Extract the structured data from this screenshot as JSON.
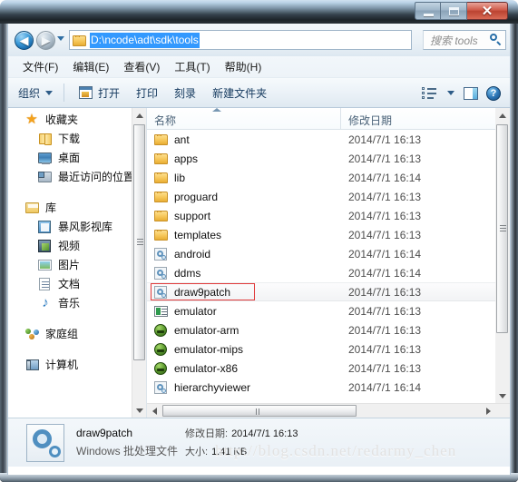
{
  "window": {
    "title": "",
    "buttons": {
      "minimize": "minimize-button",
      "maximize": "maximize-button",
      "close": "✕"
    }
  },
  "navigation": {
    "back_glyph": "◀",
    "forward_glyph": "▶",
    "address_path": "D:\\ncode\\adt\\sdk\\tools",
    "refresh_glyph": "↻"
  },
  "search": {
    "placeholder": "搜索 tools"
  },
  "menubar": {
    "items": [
      {
        "label": "文件(F)"
      },
      {
        "label": "编辑(E)"
      },
      {
        "label": "查看(V)"
      },
      {
        "label": "工具(T)"
      },
      {
        "label": "帮助(H)"
      }
    ]
  },
  "toolbar": {
    "organize_label": "组织",
    "open_label": "打开",
    "print_label": "打印",
    "burn_label": "刻录",
    "newfolder_label": "新建文件夹",
    "help_glyph": "?"
  },
  "sidebar": {
    "groups": [
      {
        "root": {
          "label": "收藏夹",
          "icon": "star-icon"
        },
        "children": [
          {
            "label": "下载",
            "icon": "folder-open-icon"
          },
          {
            "label": "桌面",
            "icon": "desktop-icon"
          },
          {
            "label": "最近访问的位置",
            "icon": "recent-places-icon"
          }
        ]
      },
      {
        "root": {
          "label": "库",
          "icon": "library-icon"
        },
        "children": [
          {
            "label": "暴风影视库",
            "icon": "video-library-icon"
          },
          {
            "label": "视频",
            "icon": "film-icon"
          },
          {
            "label": "图片",
            "icon": "picture-icon"
          },
          {
            "label": "文档",
            "icon": "document-icon"
          },
          {
            "label": "音乐",
            "icon": "music-icon"
          }
        ]
      },
      {
        "root": {
          "label": "家庭组",
          "icon": "homegroup-icon"
        },
        "children": []
      },
      {
        "root": {
          "label": "计算机",
          "icon": "computer-icon"
        },
        "children": []
      }
    ]
  },
  "filelist": {
    "columns": [
      {
        "label": "名称",
        "key": "name"
      },
      {
        "label": "修改日期",
        "key": "date"
      }
    ],
    "selected_name": "draw9patch",
    "rows": [
      {
        "name": "ant",
        "date": "2014/7/1 16:13",
        "icon": "folder-icon"
      },
      {
        "name": "apps",
        "date": "2014/7/1 16:13",
        "icon": "folder-icon"
      },
      {
        "name": "lib",
        "date": "2014/7/1 16:14",
        "icon": "folder-icon"
      },
      {
        "name": "proguard",
        "date": "2014/7/1 16:13",
        "icon": "folder-icon"
      },
      {
        "name": "support",
        "date": "2014/7/1 16:13",
        "icon": "folder-icon"
      },
      {
        "name": "templates",
        "date": "2014/7/1 16:13",
        "icon": "folder-icon"
      },
      {
        "name": "android",
        "date": "2014/7/1 16:14",
        "icon": "batch-file-icon"
      },
      {
        "name": "ddms",
        "date": "2014/7/1 16:14",
        "icon": "batch-file-icon"
      },
      {
        "name": "draw9patch",
        "date": "2014/7/1 16:13",
        "icon": "batch-file-icon"
      },
      {
        "name": "emulator",
        "date": "2014/7/1 16:13",
        "icon": "console-app-icon"
      },
      {
        "name": "emulator-arm",
        "date": "2014/7/1 16:13",
        "icon": "android-icon"
      },
      {
        "name": "emulator-mips",
        "date": "2014/7/1 16:13",
        "icon": "android-icon"
      },
      {
        "name": "emulator-x86",
        "date": "2014/7/1 16:13",
        "icon": "android-icon"
      },
      {
        "name": "hierarchyviewer",
        "date": "2014/7/1 16:14",
        "icon": "batch-file-icon"
      }
    ]
  },
  "details": {
    "file_name": "draw9patch",
    "file_type": "Windows 批处理文件",
    "modified_label": "修改日期:",
    "modified_value": "2014/7/1 16:13",
    "size_label": "大小:",
    "size_value": "1.41 KB"
  },
  "watermark": {
    "text": "http://blog.csdn.net/redarmy_chen"
  },
  "colors": {
    "accent": "#3399fe",
    "annotation": "#e03a3a",
    "close_button": "#bb4331"
  }
}
